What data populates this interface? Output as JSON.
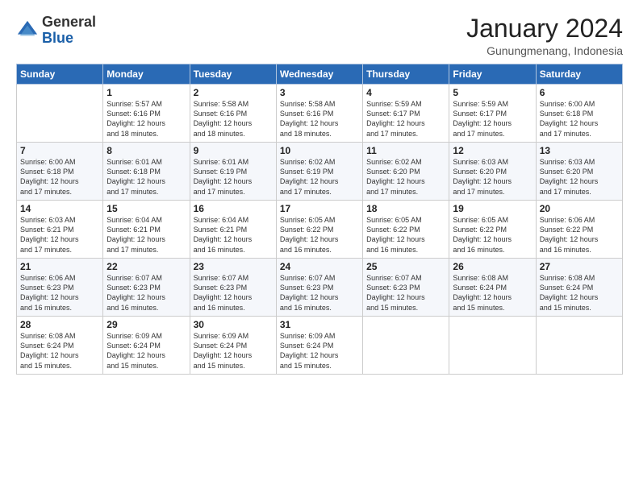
{
  "header": {
    "logo_general": "General",
    "logo_blue": "Blue",
    "month_title": "January 2024",
    "location": "Gunungmenang, Indonesia"
  },
  "days_of_week": [
    "Sunday",
    "Monday",
    "Tuesday",
    "Wednesday",
    "Thursday",
    "Friday",
    "Saturday"
  ],
  "weeks": [
    [
      {
        "day": "",
        "sunrise": "",
        "sunset": "",
        "daylight": ""
      },
      {
        "day": "1",
        "sunrise": "5:57 AM",
        "sunset": "6:16 PM",
        "daylight": "12 hours and 18 minutes."
      },
      {
        "day": "2",
        "sunrise": "5:58 AM",
        "sunset": "6:16 PM",
        "daylight": "12 hours and 18 minutes."
      },
      {
        "day": "3",
        "sunrise": "5:58 AM",
        "sunset": "6:16 PM",
        "daylight": "12 hours and 18 minutes."
      },
      {
        "day": "4",
        "sunrise": "5:59 AM",
        "sunset": "6:17 PM",
        "daylight": "12 hours and 17 minutes."
      },
      {
        "day": "5",
        "sunrise": "5:59 AM",
        "sunset": "6:17 PM",
        "daylight": "12 hours and 17 minutes."
      },
      {
        "day": "6",
        "sunrise": "6:00 AM",
        "sunset": "6:18 PM",
        "daylight": "12 hours and 17 minutes."
      }
    ],
    [
      {
        "day": "7",
        "sunrise": "6:00 AM",
        "sunset": "6:18 PM",
        "daylight": "12 hours and 17 minutes."
      },
      {
        "day": "8",
        "sunrise": "6:01 AM",
        "sunset": "6:18 PM",
        "daylight": "12 hours and 17 minutes."
      },
      {
        "day": "9",
        "sunrise": "6:01 AM",
        "sunset": "6:19 PM",
        "daylight": "12 hours and 17 minutes."
      },
      {
        "day": "10",
        "sunrise": "6:02 AM",
        "sunset": "6:19 PM",
        "daylight": "12 hours and 17 minutes."
      },
      {
        "day": "11",
        "sunrise": "6:02 AM",
        "sunset": "6:20 PM",
        "daylight": "12 hours and 17 minutes."
      },
      {
        "day": "12",
        "sunrise": "6:03 AM",
        "sunset": "6:20 PM",
        "daylight": "12 hours and 17 minutes."
      },
      {
        "day": "13",
        "sunrise": "6:03 AM",
        "sunset": "6:20 PM",
        "daylight": "12 hours and 17 minutes."
      }
    ],
    [
      {
        "day": "14",
        "sunrise": "6:03 AM",
        "sunset": "6:21 PM",
        "daylight": "12 hours and 17 minutes."
      },
      {
        "day": "15",
        "sunrise": "6:04 AM",
        "sunset": "6:21 PM",
        "daylight": "12 hours and 17 minutes."
      },
      {
        "day": "16",
        "sunrise": "6:04 AM",
        "sunset": "6:21 PM",
        "daylight": "12 hours and 16 minutes."
      },
      {
        "day": "17",
        "sunrise": "6:05 AM",
        "sunset": "6:22 PM",
        "daylight": "12 hours and 16 minutes."
      },
      {
        "day": "18",
        "sunrise": "6:05 AM",
        "sunset": "6:22 PM",
        "daylight": "12 hours and 16 minutes."
      },
      {
        "day": "19",
        "sunrise": "6:05 AM",
        "sunset": "6:22 PM",
        "daylight": "12 hours and 16 minutes."
      },
      {
        "day": "20",
        "sunrise": "6:06 AM",
        "sunset": "6:22 PM",
        "daylight": "12 hours and 16 minutes."
      }
    ],
    [
      {
        "day": "21",
        "sunrise": "6:06 AM",
        "sunset": "6:23 PM",
        "daylight": "12 hours and 16 minutes."
      },
      {
        "day": "22",
        "sunrise": "6:07 AM",
        "sunset": "6:23 PM",
        "daylight": "12 hours and 16 minutes."
      },
      {
        "day": "23",
        "sunrise": "6:07 AM",
        "sunset": "6:23 PM",
        "daylight": "12 hours and 16 minutes."
      },
      {
        "day": "24",
        "sunrise": "6:07 AM",
        "sunset": "6:23 PM",
        "daylight": "12 hours and 16 minutes."
      },
      {
        "day": "25",
        "sunrise": "6:07 AM",
        "sunset": "6:23 PM",
        "daylight": "12 hours and 15 minutes."
      },
      {
        "day": "26",
        "sunrise": "6:08 AM",
        "sunset": "6:24 PM",
        "daylight": "12 hours and 15 minutes."
      },
      {
        "day": "27",
        "sunrise": "6:08 AM",
        "sunset": "6:24 PM",
        "daylight": "12 hours and 15 minutes."
      }
    ],
    [
      {
        "day": "28",
        "sunrise": "6:08 AM",
        "sunset": "6:24 PM",
        "daylight": "12 hours and 15 minutes."
      },
      {
        "day": "29",
        "sunrise": "6:09 AM",
        "sunset": "6:24 PM",
        "daylight": "12 hours and 15 minutes."
      },
      {
        "day": "30",
        "sunrise": "6:09 AM",
        "sunset": "6:24 PM",
        "daylight": "12 hours and 15 minutes."
      },
      {
        "day": "31",
        "sunrise": "6:09 AM",
        "sunset": "6:24 PM",
        "daylight": "12 hours and 15 minutes."
      },
      {
        "day": "",
        "sunrise": "",
        "sunset": "",
        "daylight": ""
      },
      {
        "day": "",
        "sunrise": "",
        "sunset": "",
        "daylight": ""
      },
      {
        "day": "",
        "sunrise": "",
        "sunset": "",
        "daylight": ""
      }
    ]
  ]
}
